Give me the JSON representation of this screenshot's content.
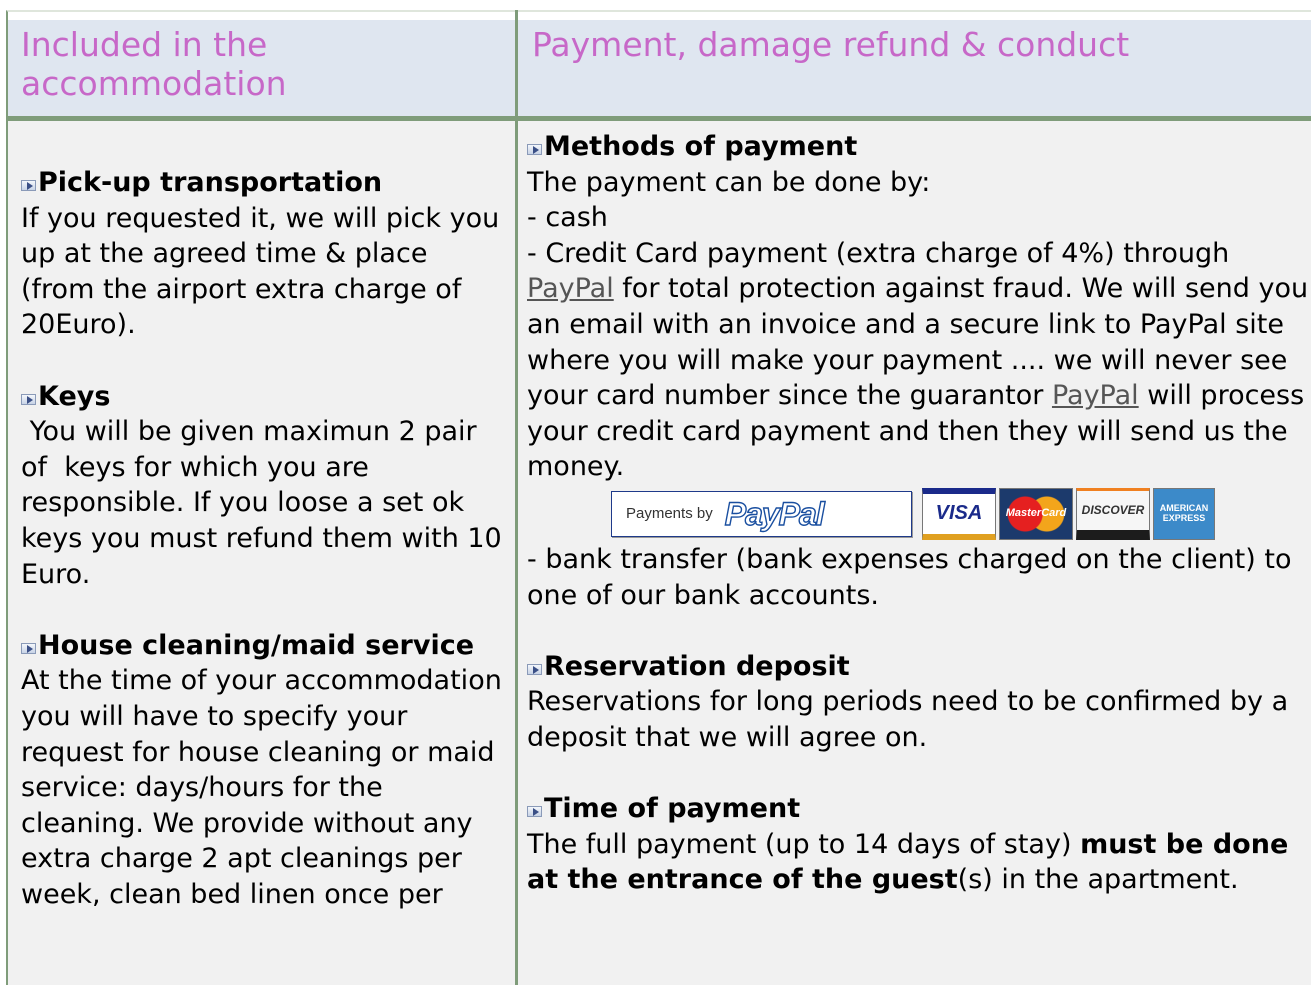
{
  "headers": {
    "left": "Included in the accommodation",
    "right": "Payment, damage refund & conduct"
  },
  "left": {
    "sections": [
      {
        "title": "Pick-up transportation",
        "text": "If you requested it, we will pick you up at the agreed time & place (from the airport extra charge of 20Euro)."
      },
      {
        "title": "Keys",
        "text": " You will be given maximun 2 pair of  keys for which you are responsible. If you loose a set ok keys you must refund them with 10 Euro."
      },
      {
        "title": "House cleaning/maid service",
        "text": "At the time of your accommodation you will have to specify your request for house cleaning or maid service: days/hours for the cleaning. We provide without any extra charge 2 apt cleanings per week, clean bed linen once per"
      }
    ]
  },
  "right": {
    "methods": {
      "title": "Methods of payment",
      "intro": "The payment can be done by:",
      "cash": "- cash",
      "cc_a": "- Credit Card payment (extra charge of 4%) through ",
      "cc_link1": "PayPal",
      "cc_b": " for total protection against fraud. We will send you an email with an invoice and a secure link to PayPal site where you will make your payment .... we will never see your card number since the guarantor ",
      "cc_link2": "PayPal",
      "cc_c": " will process your credit card payment and then they will send us the money.",
      "banner_prefix": "Payments by",
      "banner_logo": "PayPal",
      "cards": {
        "visa": "VISA",
        "mastercard": "MasterCard",
        "discover": "DISCOVER",
        "amex": "AMERICAN EXPRESS"
      },
      "bank": "- bank transfer (bank expenses charged on the client) to one of our bank accounts."
    },
    "deposit": {
      "title": "Reservation deposit",
      "text": "Reservations for long periods need to be confirmed by a deposit that we will agree on."
    },
    "time": {
      "title": "Time of payment",
      "text_a": "The full payment (up to 14 days of stay) ",
      "text_bold": "must be done at the entrance of the guest",
      "text_b": "(s) in the apartment."
    }
  }
}
